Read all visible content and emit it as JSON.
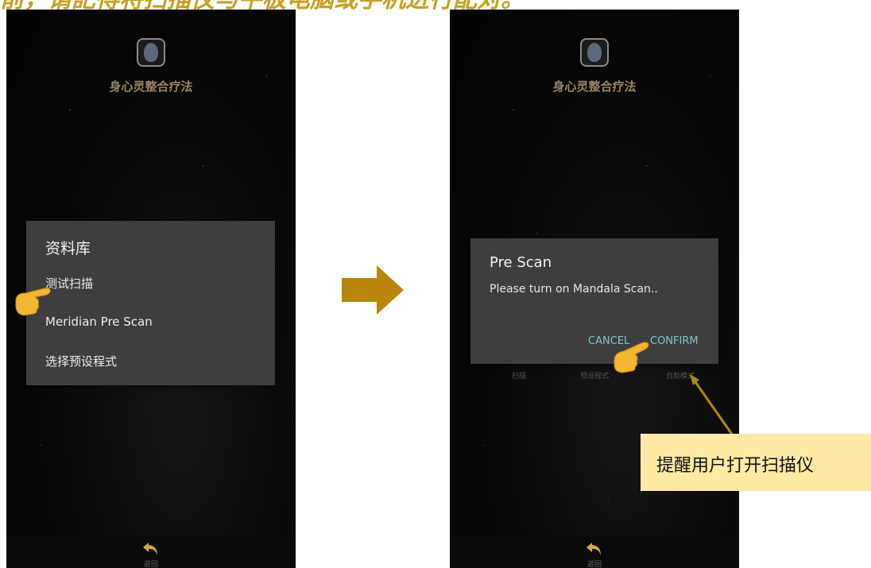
{
  "header": {
    "caption": "前，请記得将扫描仪与平板电脑或手机进行配对。"
  },
  "app": {
    "title": "身心灵整合疗法",
    "back_label": "返回"
  },
  "left_screen": {
    "menu": {
      "title": "资料库",
      "items": [
        {
          "label": "测试扫描"
        },
        {
          "label": "Meridian Pre Scan"
        },
        {
          "label": "选择预设程式"
        }
      ]
    }
  },
  "right_screen": {
    "dialog": {
      "title": "Pre Scan",
      "message": "Please turn on Mandala Scan..",
      "cancel_label": "CANCEL",
      "confirm_label": "CONFIRM"
    },
    "underlying_labels": [
      "扫描",
      "预设程式",
      "自助模式"
    ]
  },
  "annotation": {
    "text": "提醒用户打开扫描仪"
  },
  "colors": {
    "title_gold": "#c7a020",
    "arrow_gold": "#b8860b",
    "dialog_bg": "#3e3e3e",
    "button_teal": "#7cc9c6",
    "callout_bg": "#fde9a4"
  }
}
